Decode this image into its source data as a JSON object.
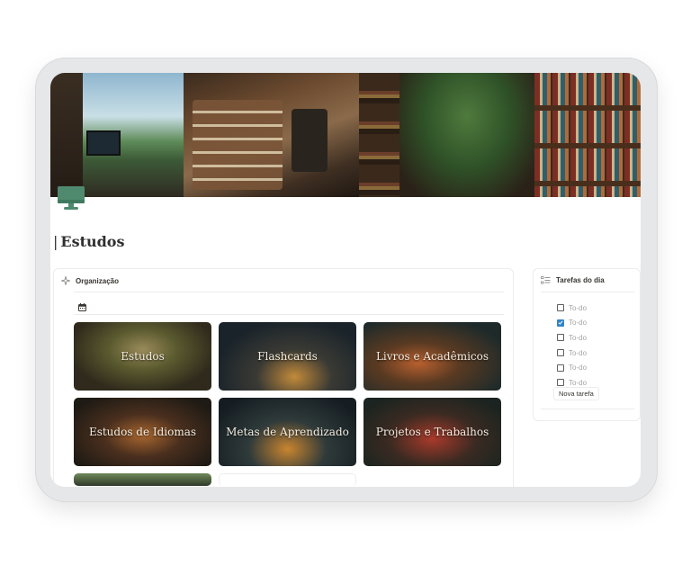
{
  "page": {
    "title": "Estudos",
    "icon": "monitor-icon"
  },
  "colors": {
    "device_frame": "#e6e7e9",
    "icon_green": "#4f8a6f",
    "checkbox_blue": "#2f83c7",
    "text_dark": "#37352f",
    "text_muted": "#a5a5a2"
  },
  "organizacao": {
    "title": "Organização",
    "header_icon": "sparkle-icon",
    "view_icon": "calendar-icon",
    "cards": [
      {
        "label": "Estudos"
      },
      {
        "label": "Flashcards"
      },
      {
        "label": "Livros e Acadêmicos"
      },
      {
        "label": "Estudos de Idiomas"
      },
      {
        "label": "Metas de Aprendizado"
      },
      {
        "label": "Projetos e Trabalhos"
      }
    ]
  },
  "tarefas": {
    "title": "Tarefas do dia",
    "header_icon": "checklist-icon",
    "items": [
      {
        "label": "To-do",
        "checked": false
      },
      {
        "label": "To-do",
        "checked": true
      },
      {
        "label": "To-do",
        "checked": false
      },
      {
        "label": "To-do",
        "checked": false
      },
      {
        "label": "To-do",
        "checked": false
      },
      {
        "label": "To-do",
        "checked": false
      }
    ],
    "new_task_label": "Nova tarefa"
  }
}
